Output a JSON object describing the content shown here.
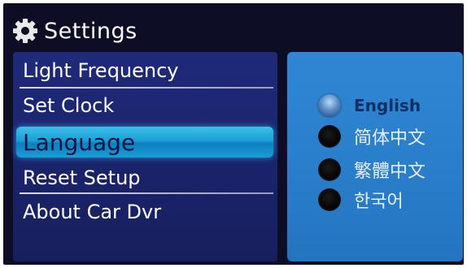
{
  "header": {
    "title": "Settings",
    "icon": "gear-icon"
  },
  "menu": {
    "items": [
      {
        "label": "Light Frequency"
      },
      {
        "label": "Set Clock"
      },
      {
        "label": "Language"
      },
      {
        "label": "Reset Setup"
      },
      {
        "label": "About Car Dvr"
      }
    ],
    "selected": "Language"
  },
  "language_options": {
    "items": [
      {
        "label": "English",
        "checked": true
      },
      {
        "label": "简体中文",
        "checked": false
      },
      {
        "label": "繁體中文",
        "checked": false
      },
      {
        "label": "한국어",
        "checked": false
      }
    ]
  },
  "colors": {
    "background": "#0d0d26",
    "menu_panel": "#1f2a7a",
    "selection_highlight": "#1b9fd6",
    "options_panel": "#2a7fcb"
  }
}
